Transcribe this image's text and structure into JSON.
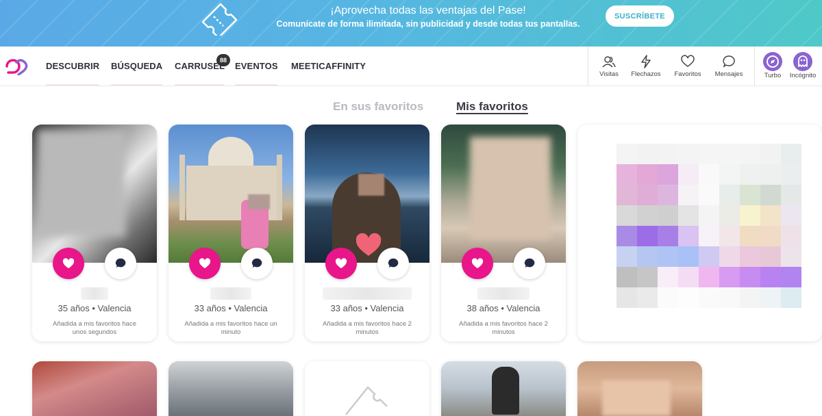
{
  "banner": {
    "title": "¡Aprovecha todas las ventajas del Pase!",
    "subtitle": "Comunícate de forma ilimitada, sin publicidad y desde todas tus pantallas.",
    "cta_label": "SUSCRÍBETE",
    "gradient_start": "#5aa9e6",
    "gradient_end": "#4fc9c8"
  },
  "nav": {
    "logo_icon": "meetic-logo-icon",
    "items": [
      {
        "label": "DESCUBRIR"
      },
      {
        "label": "BÚSQUEDA"
      },
      {
        "label": "CARRUSEL"
      },
      {
        "label": "EVENTOS"
      },
      {
        "label": "MEETICAFFINITY"
      }
    ],
    "carrusel_badge": "88",
    "actions": [
      {
        "label": "Visitas",
        "icon": "people-icon"
      },
      {
        "label": "Flechazos",
        "icon": "bolt-icon"
      },
      {
        "label": "Favoritos",
        "icon": "heart-outline-icon"
      },
      {
        "label": "Mensajes",
        "icon": "chat-bubble-icon"
      }
    ],
    "extras": [
      {
        "label": "Turbo",
        "icon": "compass-icon"
      },
      {
        "label": "Incógnito",
        "icon": "ghost-icon"
      }
    ]
  },
  "tabs": {
    "inactive": "En sus favoritos",
    "active": "Mis favoritos"
  },
  "cards": [
    {
      "meta": "35 años • Valencia",
      "added": "Añadida a mis favoritos hace unos segundos"
    },
    {
      "meta": "33 años • Valencia",
      "added": "Añadida a mis favoritos hace un minuto"
    },
    {
      "meta": "33 años • Valencia",
      "added": "Añadida a mis favoritos hace 2 minutos"
    },
    {
      "meta": "38 años • Valencia",
      "added": "Añadida a mis favoritos hace 2 minutos"
    }
  ],
  "colors": {
    "accent_pink": "#e8168a",
    "accent_purple": "#8a63d2",
    "text_dark": "#2f2f3a"
  }
}
